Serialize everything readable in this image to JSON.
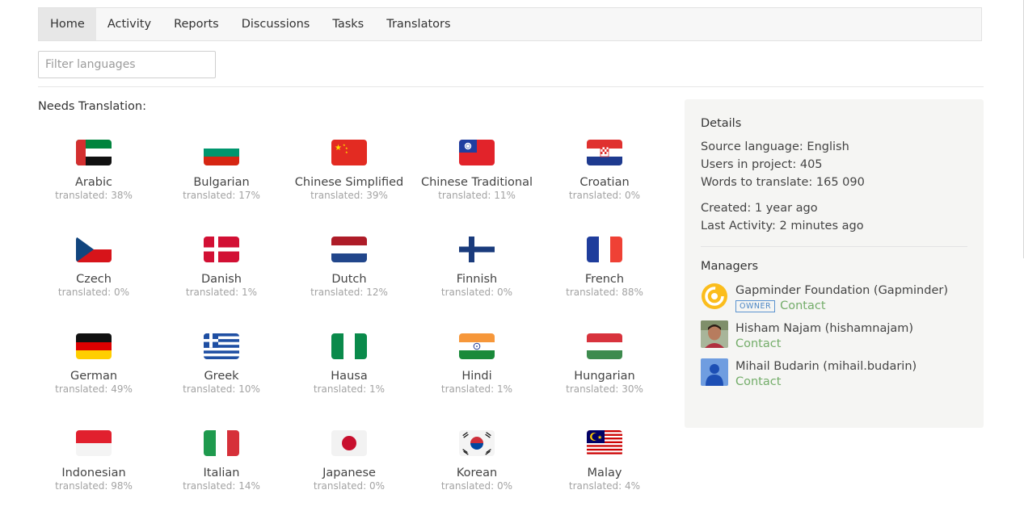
{
  "nav": {
    "tabs": [
      {
        "label": "Home",
        "active": true
      },
      {
        "label": "Activity"
      },
      {
        "label": "Reports"
      },
      {
        "label": "Discussions"
      },
      {
        "label": "Tasks"
      },
      {
        "label": "Translators"
      }
    ]
  },
  "filter": {
    "placeholder": "Filter languages"
  },
  "needs_translation": {
    "title": "Needs Translation:",
    "languages": [
      {
        "name": "Arabic",
        "progress": "translated: 38%",
        "flag": "uae-flag-icon"
      },
      {
        "name": "Bulgarian",
        "progress": "translated: 17%",
        "flag": "bulgaria-flag-icon"
      },
      {
        "name": "Chinese Simplified",
        "progress": "translated: 39%",
        "flag": "china-flag-icon"
      },
      {
        "name": "Chinese Traditional",
        "progress": "translated: 11%",
        "flag": "taiwan-flag-icon"
      },
      {
        "name": "Croatian",
        "progress": "translated: 0%",
        "flag": "croatia-flag-icon"
      },
      {
        "name": "Czech",
        "progress": "translated: 0%",
        "flag": "czech-flag-icon"
      },
      {
        "name": "Danish",
        "progress": "translated: 1%",
        "flag": "denmark-flag-icon"
      },
      {
        "name": "Dutch",
        "progress": "translated: 12%",
        "flag": "netherlands-flag-icon"
      },
      {
        "name": "Finnish",
        "progress": "translated: 0%",
        "flag": "finland-flag-icon"
      },
      {
        "name": "French",
        "progress": "translated: 88%",
        "flag": "france-flag-icon"
      },
      {
        "name": "German",
        "progress": "translated: 49%",
        "flag": "germany-flag-icon"
      },
      {
        "name": "Greek",
        "progress": "translated: 10%",
        "flag": "greece-flag-icon"
      },
      {
        "name": "Hausa",
        "progress": "translated: 1%",
        "flag": "nigeria-flag-icon"
      },
      {
        "name": "Hindi",
        "progress": "translated: 1%",
        "flag": "india-flag-icon"
      },
      {
        "name": "Hungarian",
        "progress": "translated: 30%",
        "flag": "hungary-flag-icon"
      },
      {
        "name": "Indonesian",
        "progress": "translated: 98%",
        "flag": "indonesia-flag-icon"
      },
      {
        "name": "Italian",
        "progress": "translated: 14%",
        "flag": "italy-flag-icon"
      },
      {
        "name": "Japanese",
        "progress": "translated: 0%",
        "flag": "japan-flag-icon"
      },
      {
        "name": "Korean",
        "progress": "translated: 0%",
        "flag": "korea-flag-icon"
      },
      {
        "name": "Malay",
        "progress": "translated: 4%",
        "flag": "malaysia-flag-icon"
      }
    ]
  },
  "details": {
    "title": "Details",
    "source_language": "Source language: English",
    "users": "Users in project: 405",
    "words": "Words to translate: 165 090",
    "created": "Created: 1 year ago",
    "last_activity": "Last Activity: 2 minutes ago",
    "managers_title": "Managers",
    "managers": [
      {
        "name": "Gapminder Foundation (Gapminder)",
        "badge": "OWNER",
        "contact": "Contact",
        "avatar": "gapminder-logo-icon"
      },
      {
        "name": "Hisham Najam (hishamnajam)",
        "contact": "Contact",
        "avatar": "user-photo-avatar"
      },
      {
        "name": "Mihail Budarin (mihail.budarin)",
        "contact": "Contact",
        "avatar": "default-user-icon"
      }
    ]
  },
  "colors": {
    "accent_green": "#74ad6a",
    "badge_blue": "#4b86c5",
    "panel_bg": "#f5f5f3"
  }
}
